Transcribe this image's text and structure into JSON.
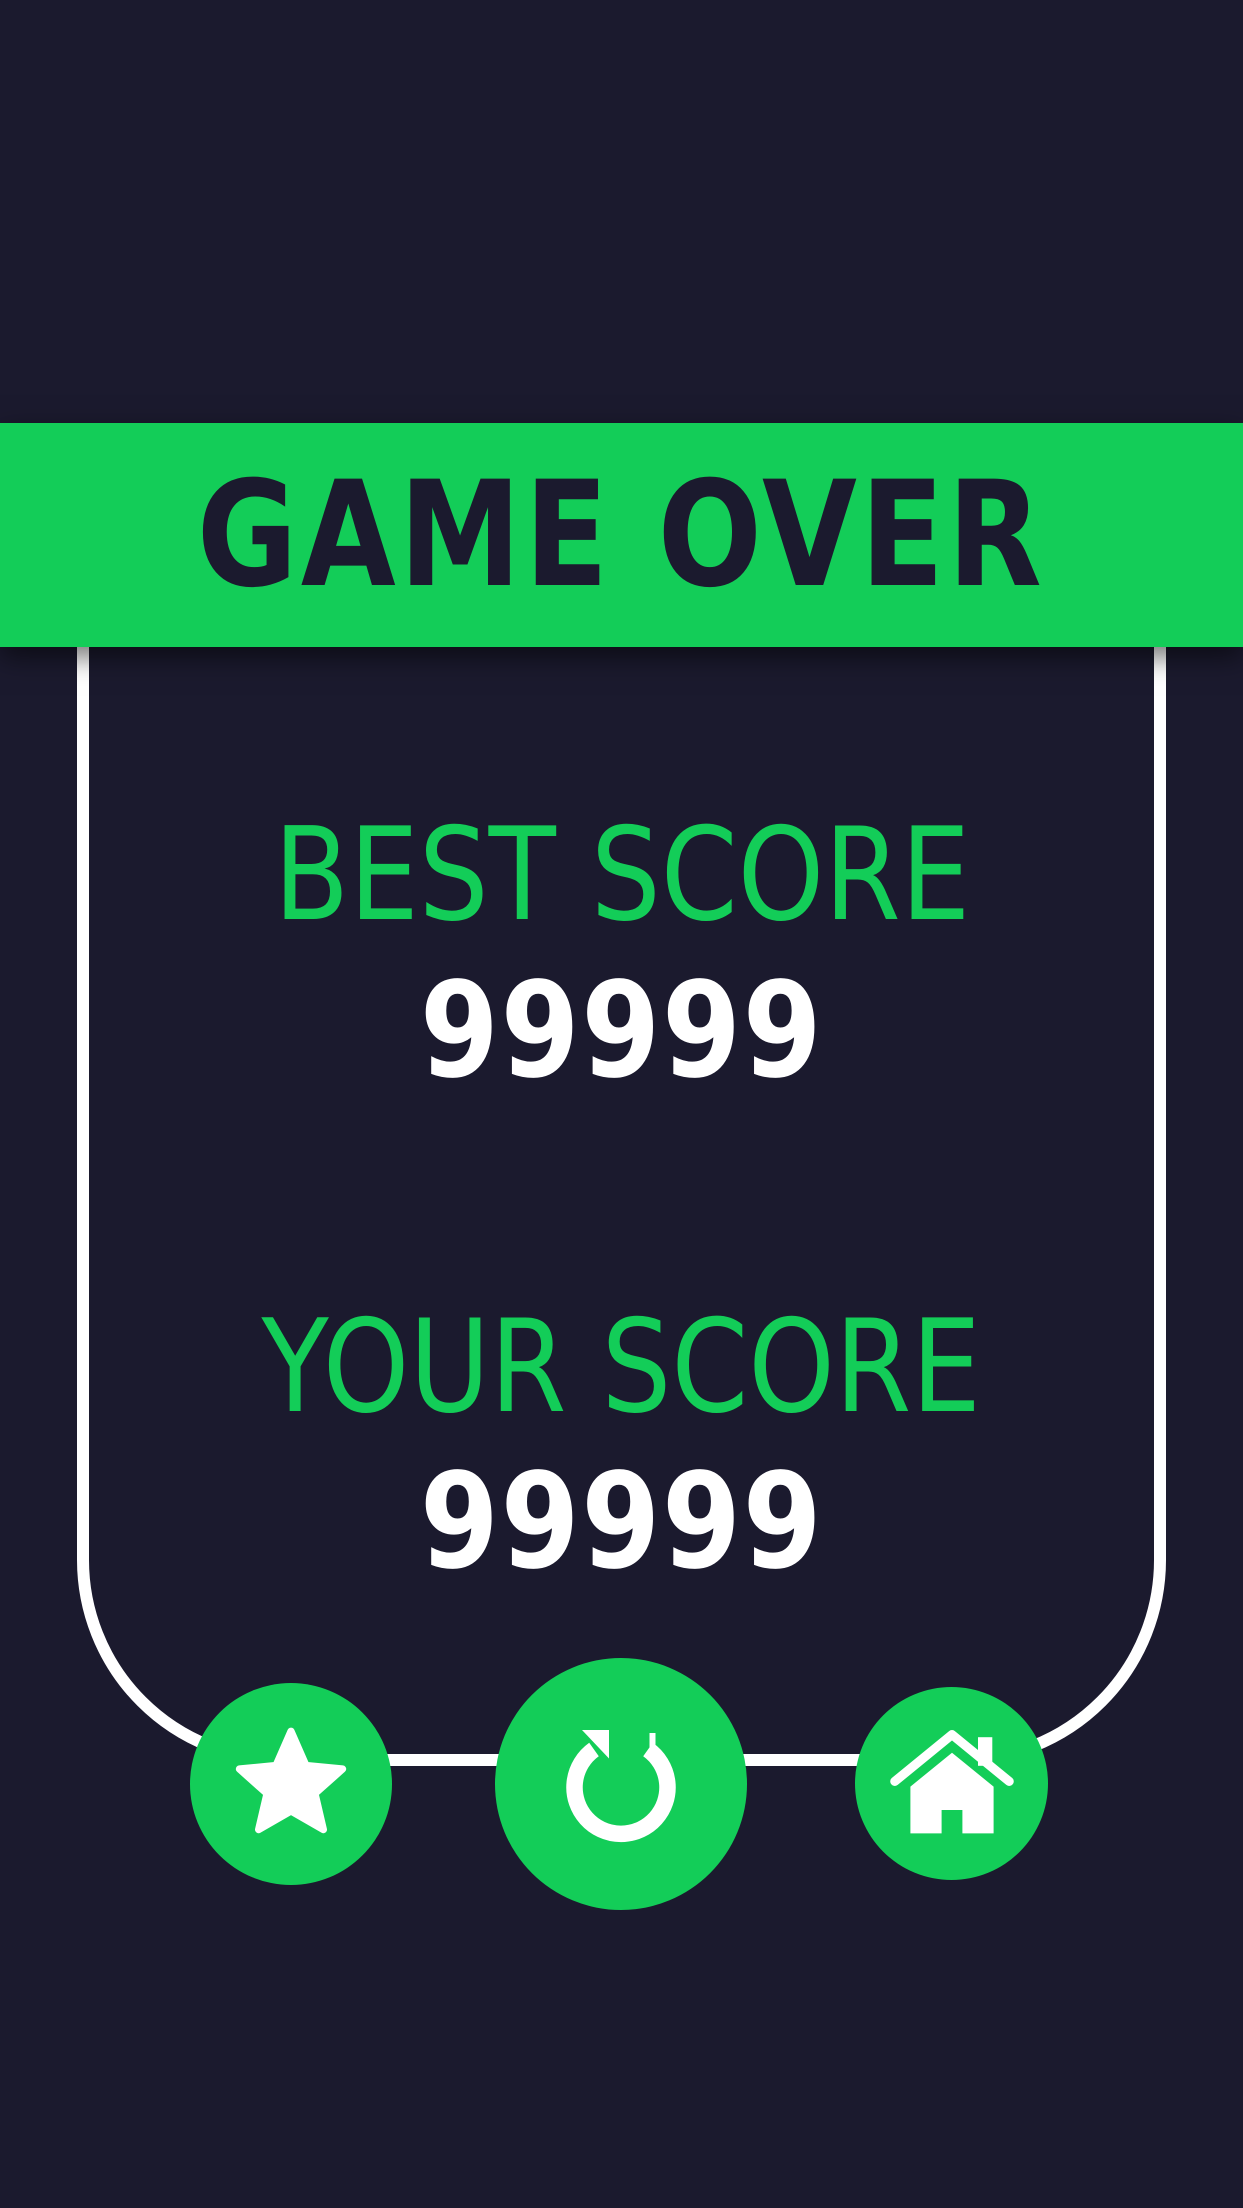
{
  "header": {
    "title": "GAME OVER"
  },
  "best": {
    "label": "BEST SCORE",
    "value": "99999"
  },
  "current": {
    "label": "YOUR SCORE",
    "value": "99999"
  },
  "buttons": {
    "rate": {
      "icon": "star-icon"
    },
    "restart": {
      "icon": "restart-icon"
    },
    "home": {
      "icon": "home-icon"
    }
  },
  "colors": {
    "background": "#1b1a2e",
    "accent": "#13cd58",
    "text": "#ffffff"
  }
}
